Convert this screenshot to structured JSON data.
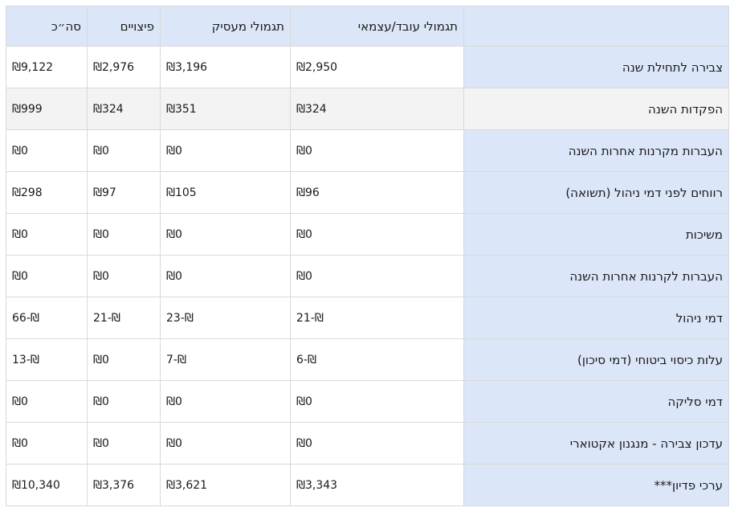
{
  "table": {
    "headers": [
      "",
      "תגמולי עובד/עצמאי",
      "תגמולי מעסיק",
      "פיצויים",
      "סה״כ"
    ],
    "rows": [
      {
        "label": "צבירה לתחילת שנה",
        "values": [
          "₪2,950",
          "₪3,196",
          "₪2,976",
          "₪9,122"
        ]
      },
      {
        "label": "הפקדות השנה",
        "values": [
          "₪324",
          "₪351",
          "₪324",
          "₪999"
        ]
      },
      {
        "label": "העברות מקרנות אחרות השנה",
        "values": [
          "₪0",
          "₪0",
          "₪0",
          "₪0"
        ]
      },
      {
        "label": "רווחים לפני דמי ניהול (תשואה)",
        "values": [
          "₪96",
          "₪105",
          "₪97",
          "₪298"
        ]
      },
      {
        "label": "משיכות",
        "values": [
          "₪0",
          "₪0",
          "₪0",
          "₪0"
        ]
      },
      {
        "label": "העברות לקרנות אחרות השנה",
        "values": [
          "₪0",
          "₪0",
          "₪0",
          "₪0"
        ]
      },
      {
        "label": "דמי ניהול",
        "values": [
          "₪-21",
          "₪-23",
          "₪-21",
          "₪-66"
        ]
      },
      {
        "label": "עלות כיסוי ביטוחי (דמי סיכון)",
        "values": [
          "₪-6",
          "₪-7",
          "₪0",
          "₪-13"
        ]
      },
      {
        "label": "דמי סליקה",
        "values": [
          "₪0",
          "₪0",
          "₪0",
          "₪0"
        ]
      },
      {
        "label": "עדכון צבירה - מנגנון אקטוארי",
        "values": [
          "₪0",
          "₪0",
          "₪0",
          "₪0"
        ]
      },
      {
        "label": "ערכי פדיון***",
        "values": [
          "₪3,343",
          "₪3,621",
          "₪3,376",
          "₪10,340"
        ]
      }
    ]
  }
}
